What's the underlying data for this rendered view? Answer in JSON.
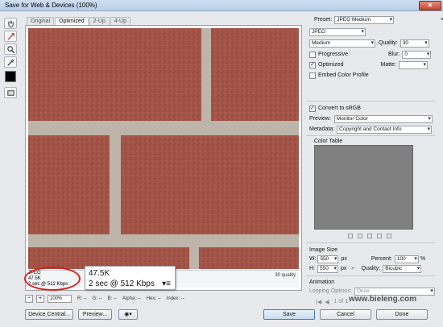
{
  "window": {
    "title": "Save for Web & Devices (100%)"
  },
  "tabs": [
    "Original",
    "Optimized",
    "2-Up",
    "4-Up"
  ],
  "tools": [
    "hand-tool-icon",
    "slice-select-tool-icon",
    "zoom-tool-icon",
    "eyedropper-tool-icon"
  ],
  "image_footer": {
    "quality_note": "30 quality"
  },
  "info_small": {
    "format": "JPEG",
    "size": "47.5K",
    "time": "2 sec @ 512 Kbps"
  },
  "zoom_callout": {
    "size": "47.5K",
    "time": "2 sec @ 512 Kbps"
  },
  "statusbar": {
    "zoom": "100%",
    "r": "R: --",
    "g": "G: --",
    "b": "B: --",
    "alpha": "Alpha: --",
    "hex": "Hex: --",
    "index": "Index: --"
  },
  "buttons": {
    "device_central": "Device Central...",
    "preview": "Preview...",
    "save": "Save",
    "cancel": "Cancel",
    "done": "Done"
  },
  "settings": {
    "preset_label": "Preset:",
    "preset_value": "JPEG Medium",
    "format_value": "JPEG",
    "compression_value": "Medium",
    "quality_label": "Quality:",
    "quality_value": "30",
    "progressive_label": "Progressive",
    "blur_label": "Blur:",
    "blur_value": "0",
    "optimized_label": "Optimized",
    "matte_label": "Matte:",
    "embed_profile_label": "Embed Color Profile",
    "convert_srgb_label": "Convert to sRGB",
    "preview_label": "Preview:",
    "preview_value": "Monitor Color",
    "metadata_label": "Metadata:",
    "metadata_value": "Copyright and Contact Info"
  },
  "color_table": {
    "title": "Color Table"
  },
  "image_size": {
    "title": "Image Size",
    "w_label": "W:",
    "w_value": "550",
    "h_label": "H:",
    "h_value": "550",
    "unit": "px",
    "percent_label": "Percent:",
    "percent_value": "100",
    "percent_unit": "%",
    "quality_label": "Quality:",
    "quality_value": "Bicubic"
  },
  "animation": {
    "title": "Animation",
    "looping_label": "Looping Options:",
    "looping_value": "Once",
    "frame_counter": "1 of 1"
  },
  "watermark": "www.bieleng.com"
}
